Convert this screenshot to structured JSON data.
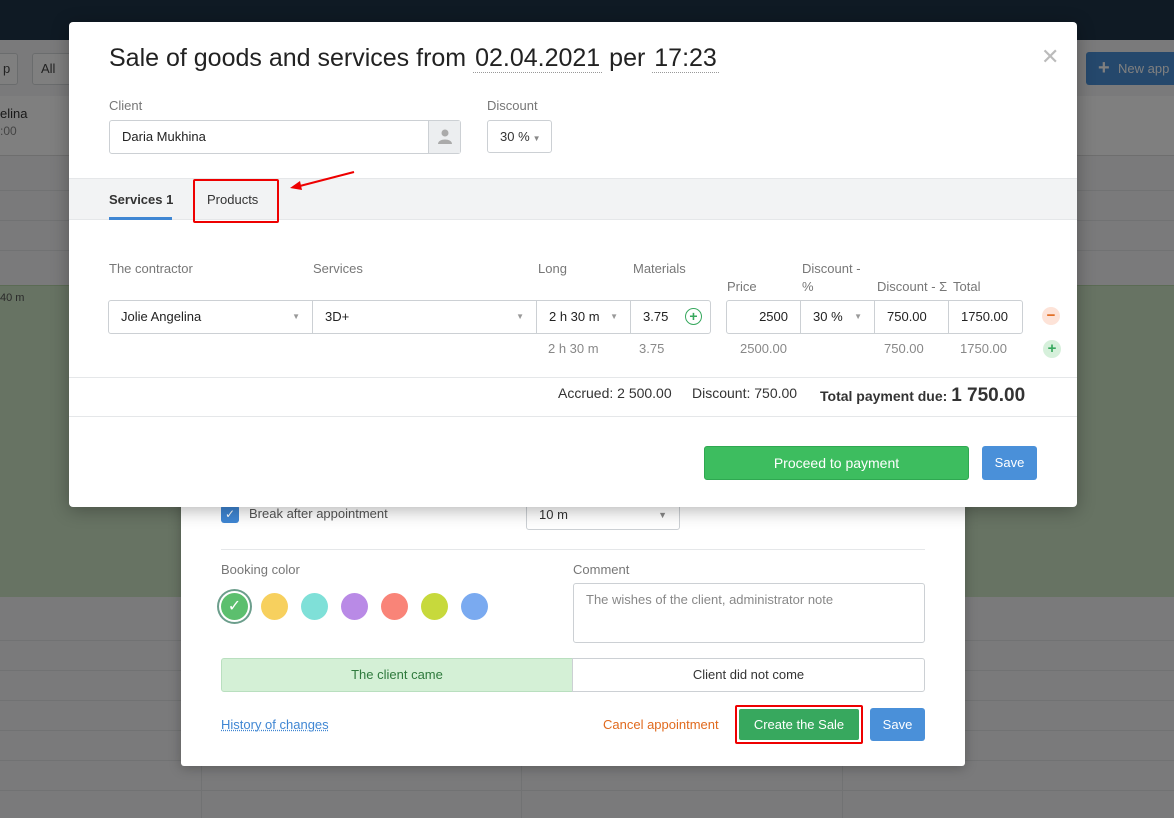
{
  "background": {
    "toolbar": {
      "left_button": "p",
      "all_staff": "All st",
      "new_appointment": "New app"
    },
    "staff": {
      "name": "elina",
      "time": ":00"
    },
    "appointment_time": "40 m"
  },
  "modal": {
    "title_prefix": "Sale of goods and services from",
    "date": "02.04.2021",
    "per": "per",
    "time": "17:23",
    "client_label": "Client",
    "client_value": "Daria Mukhina",
    "discount_label": "Discount",
    "discount_value": "30 %",
    "tabs": {
      "services": "Services 1",
      "products": "Products"
    },
    "columns": {
      "contractor": "The contractor",
      "services": "Services",
      "long": "Long",
      "materials": "Materials",
      "price": "Price",
      "discount_pct_line1": "Discount -",
      "discount_pct_line2": "%",
      "discount_sum": "Discount - Σ",
      "total": "Total"
    },
    "row": {
      "contractor": "Jolie Angelina",
      "service": "3D+",
      "long": "2 h 30 m",
      "materials": "3.75",
      "price": "2500",
      "discount_pct": "30 %",
      "discount_sum": "750.00",
      "total": "1750.00"
    },
    "subtotals": {
      "long": "2 h 30 m",
      "materials": "3.75",
      "price": "2500.00",
      "discount_sum": "750.00",
      "total": "1750.00"
    },
    "totals": {
      "accrued": "Accrued: 2 500.00",
      "discount": "Discount: 750.00",
      "total_label": "Total payment due:",
      "total_value": "1 750.00"
    },
    "buttons": {
      "proceed": "Proceed to payment",
      "save": "Save"
    }
  },
  "appointment_dialog": {
    "break_label": "Break after appointment",
    "break_value": "10 m",
    "booking_color_label": "Booking color",
    "colors": [
      "#5cbf6e",
      "#f7d05e",
      "#7fe0d8",
      "#b98ae6",
      "#f98478",
      "#c7d93c",
      "#7aaaf0"
    ],
    "comment_label": "Comment",
    "comment_placeholder": "The wishes of the client, administrator note",
    "client_came": "The client came",
    "client_did_not_come": "Client did not come",
    "history": "History of changes",
    "cancel": "Cancel appointment",
    "create_sale": "Create the Sale",
    "save": "Save"
  }
}
